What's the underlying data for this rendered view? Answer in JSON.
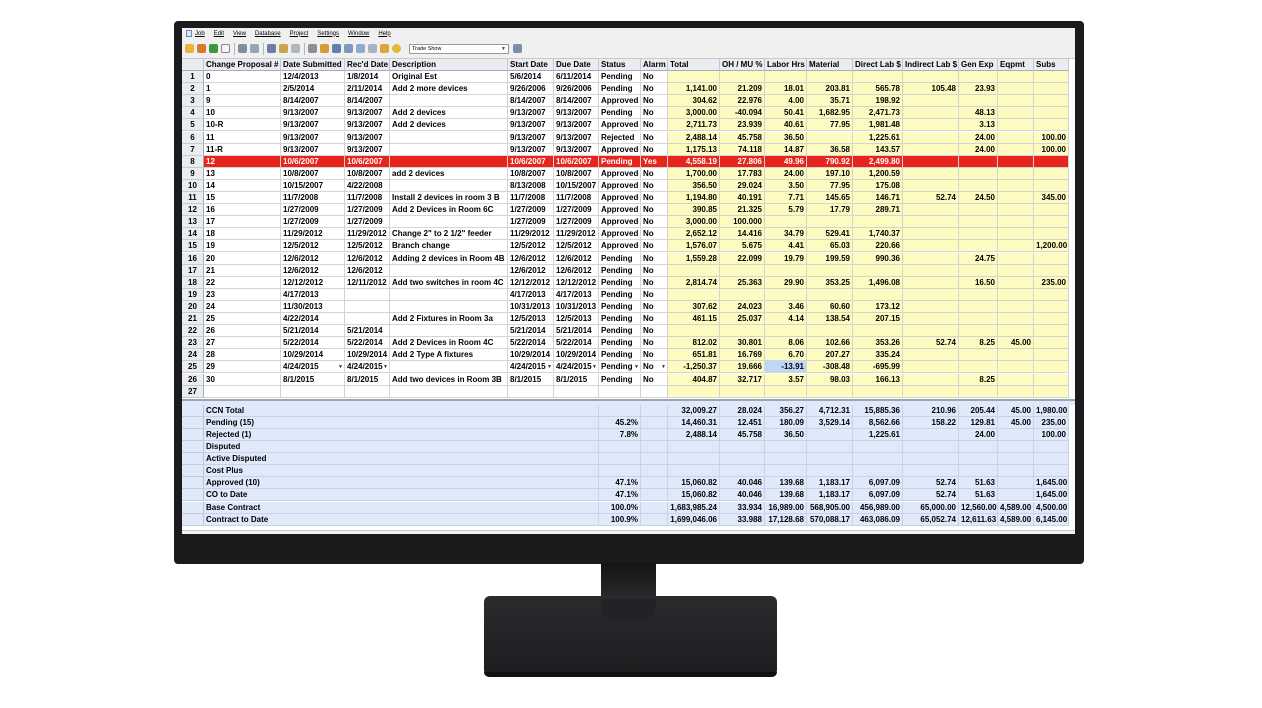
{
  "menu": [
    "Job",
    "Edit",
    "View",
    "Database",
    "Project",
    "Settings",
    "Window",
    "Help"
  ],
  "toolbar": {
    "dropdown_value": "Trade Show"
  },
  "columns": [
    "Change Proposal #",
    "Date Submitted",
    "Rec'd Date",
    "Description",
    "Start Date",
    "Due Date",
    "Status",
    "Alarm",
    "Total",
    "OH / MU %",
    "Labor Hrs",
    "Material",
    "Direct Lab $",
    "Indirect Lab $",
    "Gen Exp",
    "Eqpmt",
    "Subs"
  ],
  "rows": [
    [
      "1",
      "0",
      "12/4/2013",
      "1/8/2014",
      "Original Est",
      "5/6/2014",
      "6/11/2014",
      "Pending",
      "No",
      "",
      "",
      "",
      "",
      "",
      "",
      "",
      "",
      ""
    ],
    [
      "2",
      "1",
      "2/5/2014",
      "2/11/2014",
      "Add 2 more devices",
      "9/26/2006",
      "9/26/2006",
      "Pending",
      "No",
      "1,141.00",
      "21.209",
      "18.01",
      "203.81",
      "565.78",
      "105.48",
      "23.93",
      "",
      ""
    ],
    [
      "3",
      "9",
      "8/14/2007",
      "8/14/2007",
      "",
      "8/14/2007",
      "8/14/2007",
      "Approved",
      "No",
      "304.62",
      "22.976",
      "4.00",
      "35.71",
      "198.92",
      "",
      "",
      "",
      ""
    ],
    [
      "4",
      "10",
      "9/13/2007",
      "9/13/2007",
      "Add 2 devices",
      "9/13/2007",
      "9/13/2007",
      "Pending",
      "No",
      "3,000.00",
      "-40.094",
      "50.41",
      "1,682.95",
      "2,471.73",
      "",
      "48.13",
      "",
      ""
    ],
    [
      "5",
      "10-R",
      "9/13/2007",
      "9/13/2007",
      "Add 2 devices",
      "9/13/2007",
      "9/13/2007",
      "Approved",
      "No",
      "2,711.73",
      "23.939",
      "40.61",
      "77.95",
      "1,981.48",
      "",
      "3.13",
      "",
      ""
    ],
    [
      "6",
      "11",
      "9/13/2007",
      "9/13/2007",
      "",
      "9/13/2007",
      "9/13/2007",
      "Rejected",
      "No",
      "2,488.14",
      "45.758",
      "36.50",
      "",
      "1,225.61",
      "",
      "24.00",
      "",
      "100.00"
    ],
    [
      "7",
      "11-R",
      "9/13/2007",
      "9/13/2007",
      "",
      "9/13/2007",
      "9/13/2007",
      "Approved",
      "No",
      "1,175.13",
      "74.118",
      "14.87",
      "36.58",
      "143.57",
      "",
      "24.00",
      "",
      "100.00"
    ],
    [
      "8",
      "12",
      "10/6/2007",
      "10/6/2007",
      "",
      "10/6/2007",
      "10/6/2007",
      "Pending",
      "Yes",
      "4,558.19",
      "27.806",
      "49.96",
      "790.92",
      "2,499.80",
      "",
      "",
      "",
      ""
    ],
    [
      "9",
      "13",
      "10/8/2007",
      "10/8/2007",
      "add 2 devices",
      "10/8/2007",
      "10/8/2007",
      "Approved",
      "No",
      "1,700.00",
      "17.783",
      "24.00",
      "197.10",
      "1,200.59",
      "",
      "",
      "",
      ""
    ],
    [
      "10",
      "14",
      "10/15/2007",
      "4/22/2008",
      "",
      "8/13/2008",
      "10/15/2007",
      "Approved",
      "No",
      "356.50",
      "29.024",
      "3.50",
      "77.95",
      "175.08",
      "",
      "",
      "",
      ""
    ],
    [
      "11",
      "15",
      "11/7/2008",
      "11/7/2008",
      "Install 2 devices in room 3 B",
      "11/7/2008",
      "11/7/2008",
      "Approved",
      "No",
      "1,194.80",
      "40.191",
      "7.71",
      "145.65",
      "146.71",
      "52.74",
      "24.50",
      "",
      "345.00"
    ],
    [
      "12",
      "16",
      "1/27/2009",
      "1/27/2009",
      "Add 2 Devices in Room 6C",
      "1/27/2009",
      "1/27/2009",
      "Approved",
      "No",
      "390.85",
      "21.325",
      "5.79",
      "17.79",
      "289.71",
      "",
      "",
      "",
      ""
    ],
    [
      "13",
      "17",
      "1/27/2009",
      "1/27/2009",
      "",
      "1/27/2009",
      "1/27/2009",
      "Approved",
      "No",
      "3,000.00",
      "100.000",
      "",
      "",
      "",
      "",
      "",
      "",
      ""
    ],
    [
      "14",
      "18",
      "11/29/2012",
      "11/29/2012",
      "Change 2\" to 2 1/2\" feeder",
      "11/29/2012",
      "11/29/2012",
      "Approved",
      "No",
      "2,652.12",
      "14.416",
      "34.79",
      "529.41",
      "1,740.37",
      "",
      "",
      "",
      ""
    ],
    [
      "15",
      "19",
      "12/5/2012",
      "12/5/2012",
      "Branch change",
      "12/5/2012",
      "12/5/2012",
      "Approved",
      "No",
      "1,576.07",
      "5.675",
      "4.41",
      "65.03",
      "220.66",
      "",
      "",
      "",
      "1,200.00"
    ],
    [
      "16",
      "20",
      "12/6/2012",
      "12/6/2012",
      "Adding 2 devices in Room 4B",
      "12/6/2012",
      "12/6/2012",
      "Pending",
      "No",
      "1,559.28",
      "22.099",
      "19.79",
      "199.59",
      "990.36",
      "",
      "24.75",
      "",
      ""
    ],
    [
      "17",
      "21",
      "12/6/2012",
      "12/6/2012",
      "",
      "12/6/2012",
      "12/6/2012",
      "Pending",
      "No",
      "",
      "",
      "",
      "",
      "",
      "",
      "",
      "",
      ""
    ],
    [
      "18",
      "22",
      "12/12/2012",
      "12/11/2012",
      "Add two switches in room 4C",
      "12/12/2012",
      "12/12/2012",
      "Pending",
      "No",
      "2,814.74",
      "25.363",
      "29.90",
      "353.25",
      "1,496.08",
      "",
      "16.50",
      "",
      "235.00"
    ],
    [
      "19",
      "23",
      "4/17/2013",
      "",
      "",
      "4/17/2013",
      "4/17/2013",
      "Pending",
      "No",
      "",
      "",
      "",
      "",
      "",
      "",
      "",
      "",
      ""
    ],
    [
      "20",
      "24",
      "11/30/2013",
      "",
      "",
      "10/31/2013",
      "10/31/2013",
      "Pending",
      "No",
      "307.62",
      "24.023",
      "3.46",
      "60.60",
      "173.12",
      "",
      "",
      "",
      ""
    ],
    [
      "21",
      "25",
      "4/22/2014",
      "",
      "Add 2 Fixtures in Room 3a",
      "12/5/2013",
      "12/5/2013",
      "Pending",
      "No",
      "461.15",
      "25.037",
      "4.14",
      "138.54",
      "207.15",
      "",
      "",
      "",
      ""
    ],
    [
      "22",
      "26",
      "5/21/2014",
      "5/21/2014",
      "",
      "5/21/2014",
      "5/21/2014",
      "Pending",
      "No",
      "",
      "",
      "",
      "",
      "",
      "",
      "",
      "",
      ""
    ],
    [
      "23",
      "27",
      "5/22/2014",
      "5/22/2014",
      "Add 2 Devices in Room 4C",
      "5/22/2014",
      "5/22/2014",
      "Pending",
      "No",
      "812.02",
      "30.801",
      "8.06",
      "102.66",
      "353.26",
      "52.74",
      "8.25",
      "45.00",
      ""
    ],
    [
      "24",
      "28",
      "10/29/2014",
      "10/29/2014",
      "Add 2 Type A fixtures",
      "10/29/2014",
      "10/29/2014",
      "Pending",
      "No",
      "651.81",
      "16.769",
      "6.70",
      "207.27",
      "335.24",
      "",
      "",
      "",
      ""
    ],
    [
      "25",
      "29",
      "4/24/2015",
      "4/24/2015",
      "",
      "4/24/2015",
      "4/24/2015",
      "Pending",
      "No",
      "-1,250.37",
      "19.666",
      "-13.91",
      "-308.48",
      "-695.99",
      "",
      "",
      "",
      ""
    ],
    [
      "26",
      "30",
      "8/1/2015",
      "8/1/2015",
      "Add two devices in Room 3B",
      "8/1/2015",
      "8/1/2015",
      "Pending",
      "No",
      "404.87",
      "32.717",
      "3.57",
      "98.03",
      "166.13",
      "",
      "8.25",
      "",
      ""
    ],
    [
      "27",
      "",
      "",
      "",
      "",
      "",
      "",
      "",
      "",
      "",
      "",
      "",
      "",
      "",
      "",
      "",
      "",
      ""
    ]
  ],
  "summary": [
    [
      "CCN Total",
      "",
      "32,009.27",
      "28.024",
      "356.27",
      "4,712.31",
      "15,885.36",
      "210.96",
      "205.44",
      "45.00",
      "1,980.00"
    ],
    [
      "Pending (15)",
      "45.2%",
      "14,460.31",
      "12.451",
      "180.09",
      "3,529.14",
      "8,562.66",
      "158.22",
      "129.81",
      "45.00",
      "235.00"
    ],
    [
      "Rejected (1)",
      "7.8%",
      "2,488.14",
      "45.758",
      "36.50",
      "",
      "1,225.61",
      "",
      "24.00",
      "",
      "100.00"
    ],
    [
      "Disputed",
      "",
      "",
      "",
      "",
      "",
      "",
      "",
      "",
      "",
      ""
    ],
    [
      "Active Disputed",
      "",
      "",
      "",
      "",
      "",
      "",
      "",
      "",
      "",
      ""
    ],
    [
      "Cost Plus",
      "",
      "",
      "",
      "",
      "",
      "",
      "",
      "",
      "",
      ""
    ],
    [
      "Approved (10)",
      "47.1%",
      "15,060.82",
      "40.046",
      "139.68",
      "1,183.17",
      "6,097.09",
      "52.74",
      "51.63",
      "",
      "1,645.00"
    ],
    [
      "CO to Date",
      "47.1%",
      "15,060.82",
      "40.046",
      "139.68",
      "1,183.17",
      "6,097.09",
      "52.74",
      "51.63",
      "",
      "1,645.00"
    ],
    [
      "Base Contract",
      "100.0%",
      "1,683,985.24",
      "33.934",
      "16,989.00",
      "568,905.00",
      "456,989.00",
      "65,000.00",
      "12,560.00",
      "4,589.00",
      "4,500.00"
    ],
    [
      "Contract to Date",
      "100.9%",
      "1,699,046.06",
      "33.988",
      "17,128.68",
      "570,088.17",
      "463,086.09",
      "65,052.74",
      "12,611.63",
      "4,589.00",
      "6,145.00"
    ]
  ],
  "colors": {
    "highlight_row": "#e8251d",
    "yellow_cells": "#fdfbbf",
    "summary_band": "#dfe9f9"
  }
}
